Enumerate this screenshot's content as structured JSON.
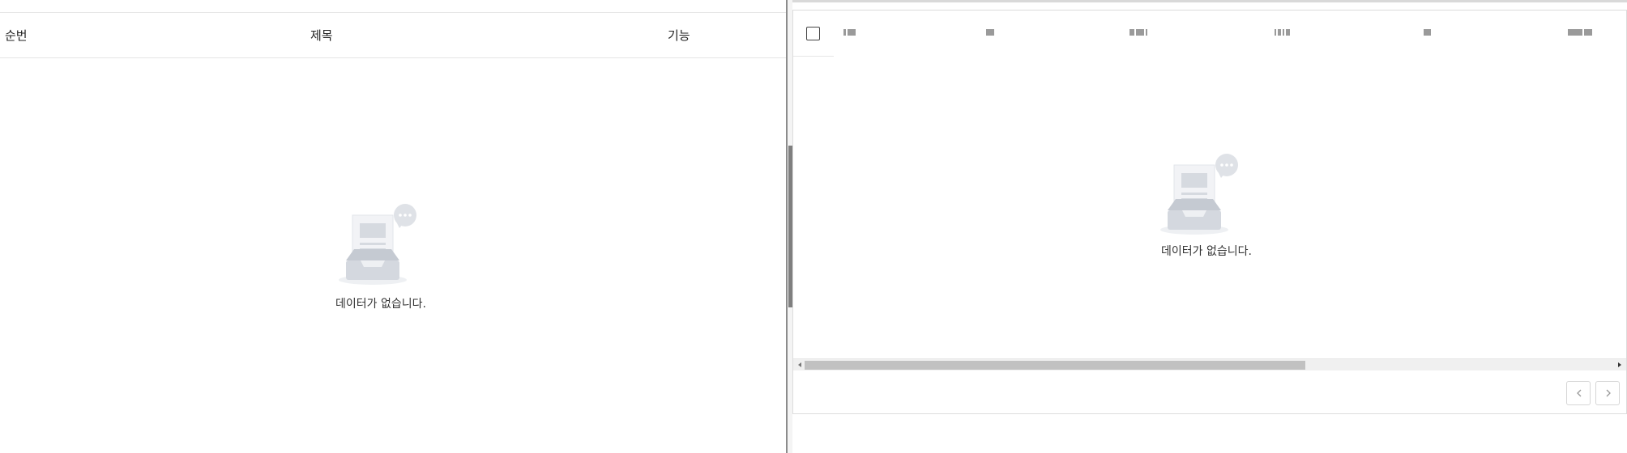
{
  "left_table": {
    "columns": [
      "순번",
      "제목",
      "기능"
    ],
    "empty_message": "데이터가 없습니다."
  },
  "right_table": {
    "empty_message": "데이터가 없습니다.",
    "select_all_checked": false
  },
  "pagination": {
    "prev_icon": "chevron-left-icon",
    "next_icon": "chevron-right-icon"
  },
  "colors": {
    "border": "#e6e6e6",
    "scroll_thumb": "#c1c1c1",
    "empty_icon": "#d9dde3"
  }
}
